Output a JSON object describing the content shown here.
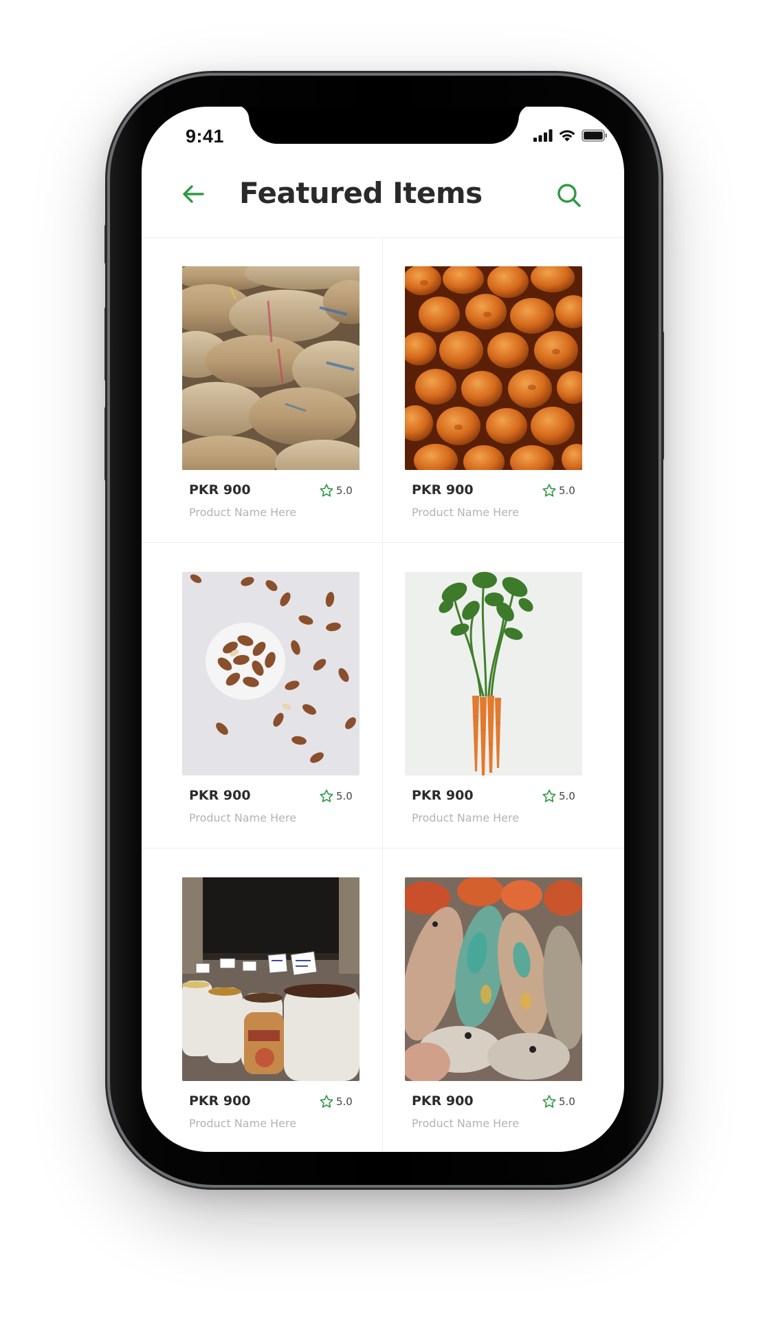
{
  "status_bar": {
    "time": "9:41"
  },
  "header": {
    "title": "Featured Items",
    "back_icon": "arrow-left-icon",
    "search_icon": "search-icon"
  },
  "colors": {
    "accent": "#2e9a44",
    "title": "#2a2a2a",
    "muted": "#b3b3b3"
  },
  "products": [
    {
      "price": "PKR 900",
      "rating": "5.0",
      "name": "Product Name Here",
      "image": "burlap-sacks"
    },
    {
      "price": "PKR 900",
      "rating": "5.0",
      "name": "Product Name Here",
      "image": "dried-apricots"
    },
    {
      "price": "PKR 900",
      "rating": "5.0",
      "name": "Product Name Here",
      "image": "almonds"
    },
    {
      "price": "PKR 900",
      "rating": "5.0",
      "name": "Product Name Here",
      "image": "carrots"
    },
    {
      "price": "PKR 900",
      "rating": "5.0",
      "name": "Product Name Here",
      "image": "spice-sacks"
    },
    {
      "price": "PKR 900",
      "rating": "5.0",
      "name": "Product Name Here",
      "image": "fish"
    }
  ]
}
